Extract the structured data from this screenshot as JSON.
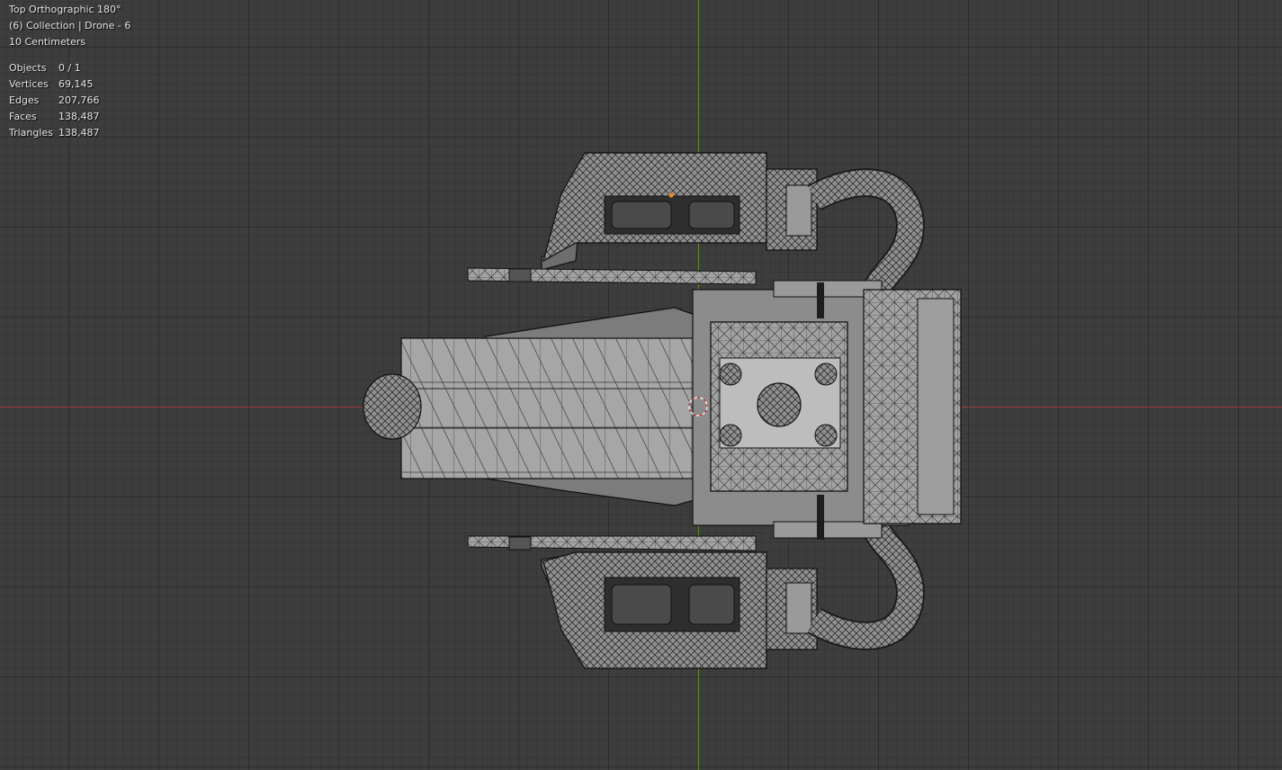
{
  "viewport": {
    "view_name": "Top Orthographic 180°",
    "collection_line": "(6) Collection | Drone - 6",
    "grid_scale": "10 Centimeters"
  },
  "stats": {
    "rows": [
      {
        "label": "Objects",
        "value": "0 / 1"
      },
      {
        "label": "Vertices",
        "value": "69,145"
      },
      {
        "label": "Edges",
        "value": "207,766"
      },
      {
        "label": "Faces",
        "value": "138,487"
      },
      {
        "label": "Triangles",
        "value": "138,487"
      }
    ]
  },
  "colors": {
    "background": "#3d3d3d",
    "x_axis": "#9b3a3a",
    "y_axis": "#5f8a33",
    "mesh_face": "#9a9a9a",
    "mesh_wire": "#1a1a1a",
    "origin": "#e8892a"
  }
}
